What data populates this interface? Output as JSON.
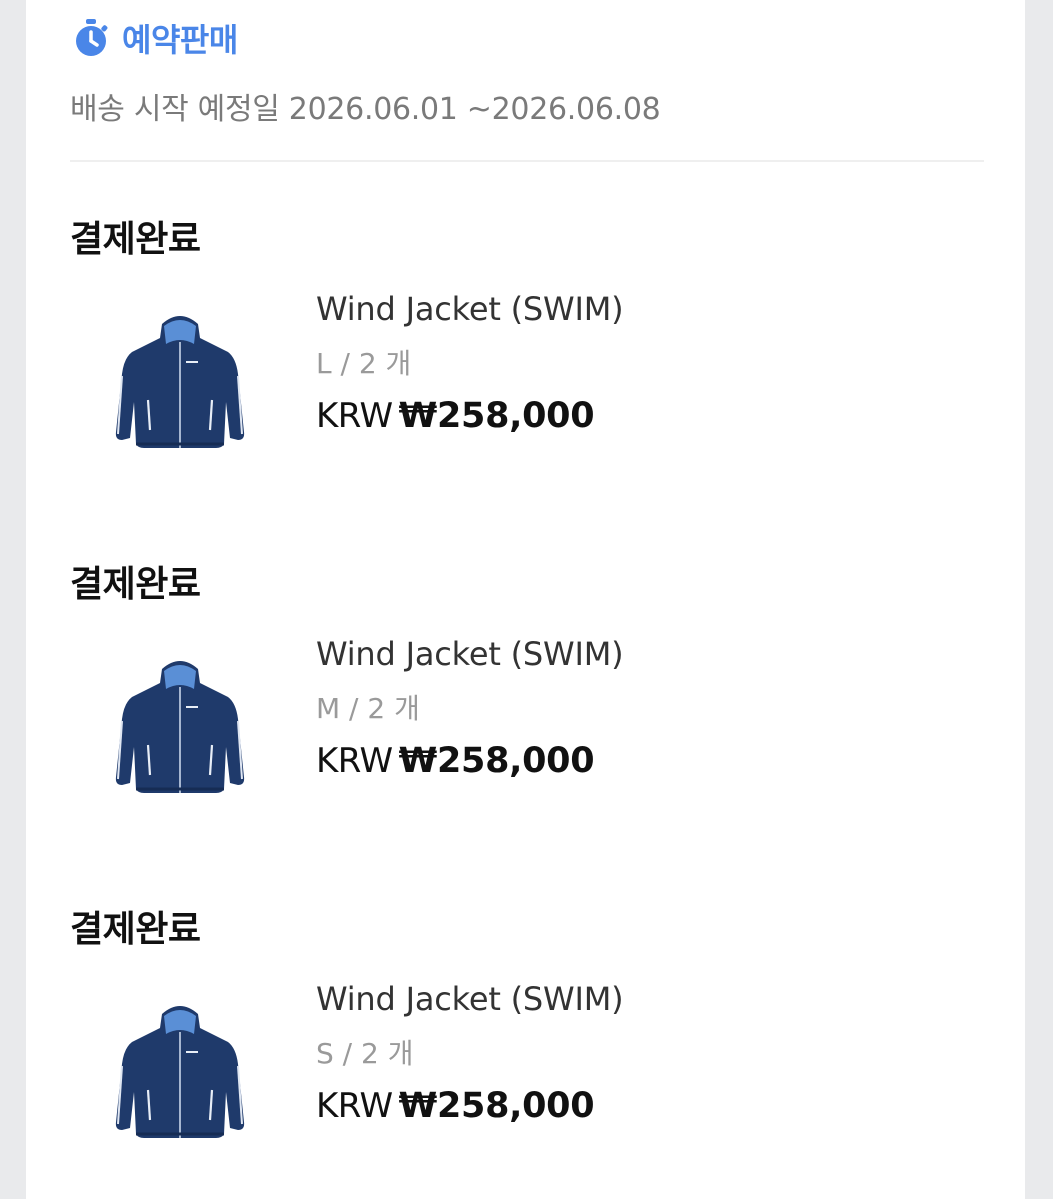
{
  "preorder": {
    "icon": "stopwatch-icon",
    "label": "예약판매",
    "color": "#4a86e8",
    "ship_text": "배송 시작 예정일 2026.06.01 ~2026.06.08"
  },
  "orders": [
    {
      "status": "결제완료",
      "name": "Wind Jacket (SWIM)",
      "option": "L / 2 개",
      "currency": "KRW",
      "price": "₩258,000"
    },
    {
      "status": "결제완료",
      "name": "Wind Jacket (SWIM)",
      "option": "M / 2 개",
      "currency": "KRW",
      "price": "₩258,000"
    },
    {
      "status": "결제완료",
      "name": "Wind Jacket (SWIM)",
      "option": "S / 2 개",
      "currency": "KRW",
      "price": "₩258,000"
    }
  ],
  "colors": {
    "jacket": "#1f3a6b",
    "jacket_shadow": "#162c54",
    "lining": "#5a8fd6"
  }
}
